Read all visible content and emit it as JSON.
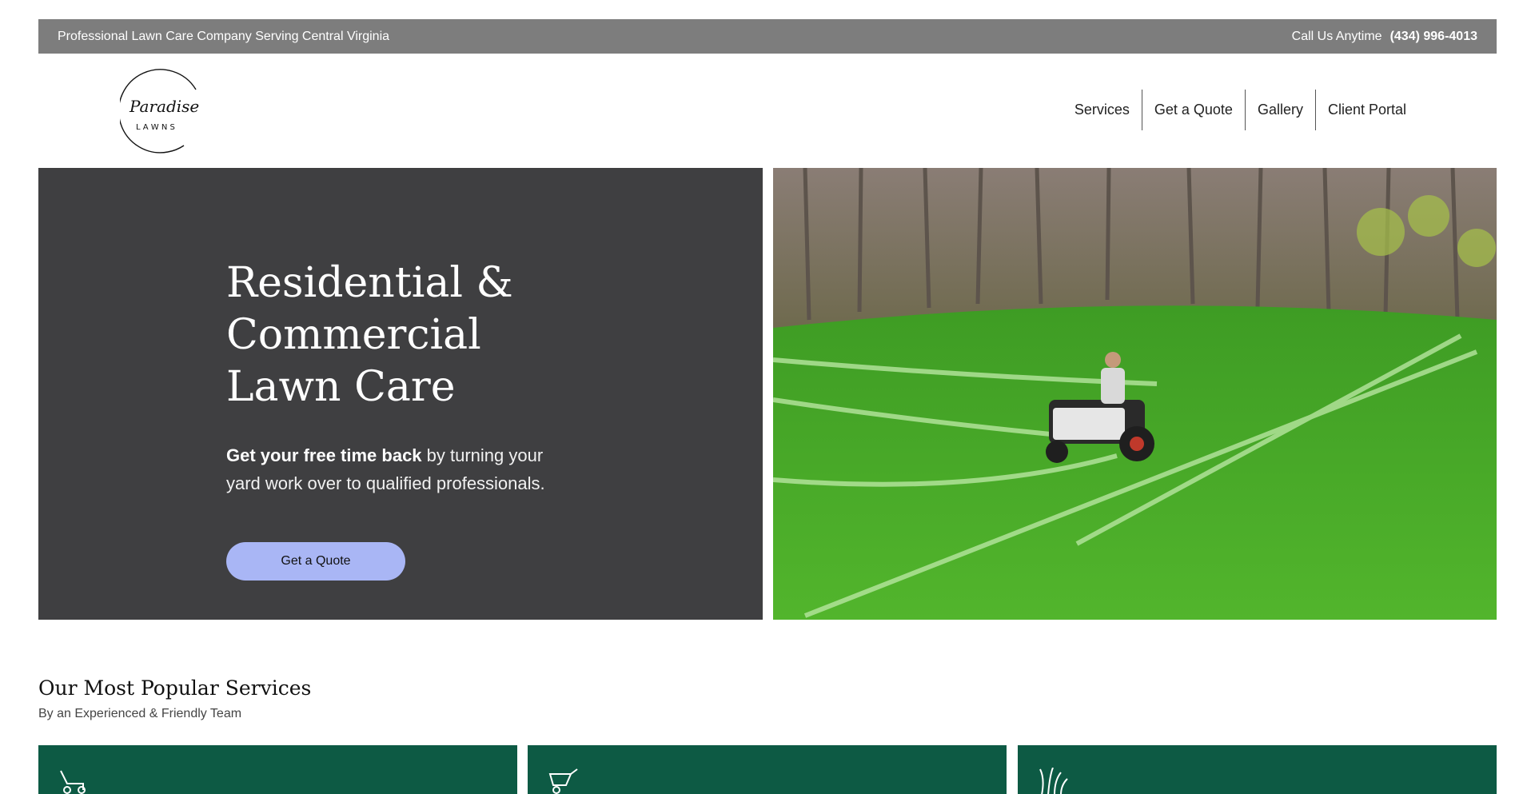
{
  "topbar": {
    "tagline": "Professional Lawn Care Company Serving Central Virginia",
    "call_label": "Call Us Anytime",
    "phone": "(434) 996-4013"
  },
  "logo": {
    "script": "Paradise",
    "word": "L A W N S"
  },
  "nav": {
    "items": [
      "Services",
      "Get a Quote",
      "Gallery",
      "Client Portal"
    ]
  },
  "hero": {
    "title_line1": "Residential &",
    "title_line2": "Commercial",
    "title_line3": "Lawn Care",
    "sub_bold": "Get your free time back",
    "sub_rest": " by turning your yard work over to qualified professionals.",
    "cta_label": "Get a Quote",
    "image_icon": "mowing-photo"
  },
  "services": {
    "title": "Our Most Popular Services",
    "subtitle": "By an Experienced & Friendly Team",
    "cards": [
      {
        "icon": "lawn-mower-icon"
      },
      {
        "icon": "wheelbarrow-icon"
      },
      {
        "icon": "grass-icon"
      }
    ]
  },
  "colors": {
    "topbar_bg": "#7d7d7d",
    "hero_bg": "#3f3f41",
    "cta_bg": "#a9b6f5",
    "card_bg": "#0d5a44",
    "grass": "#3fa526"
  }
}
